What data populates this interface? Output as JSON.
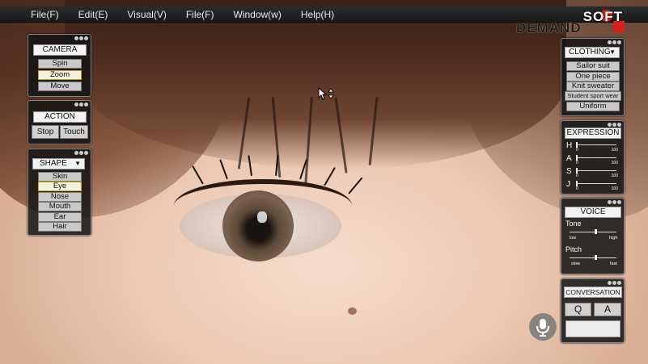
{
  "menu": [
    "File(F)",
    "Edit(E)",
    "Visual(V)",
    "File(F)",
    "Window(w)",
    "Help(H)"
  ],
  "logo": {
    "top": "SOFT",
    "bottom": "DEMAND",
    "accent_color": "#d4231e"
  },
  "camera": {
    "title": "CAMERA",
    "buttons": [
      "Spin",
      "Zoom",
      "Move"
    ],
    "active": "Zoom"
  },
  "action": {
    "title": "ACTION",
    "buttons": [
      "Stop",
      "Touch"
    ]
  },
  "shape": {
    "title": "SHAPE",
    "buttons": [
      "Skin",
      "Eye",
      "Nose",
      "Mouth",
      "Ear",
      "Hair"
    ],
    "active": "Eye"
  },
  "clothing": {
    "title": "CLOTHING",
    "items": [
      "Sailor suit",
      "One piece",
      "Knit sweater",
      "Student sport wear",
      "Uniform"
    ]
  },
  "expression": {
    "title": "EXPRESSION",
    "sliders": [
      {
        "label": "H",
        "min": "0",
        "max": "100",
        "value": 0
      },
      {
        "label": "A",
        "min": "0",
        "max": "100",
        "value": 0
      },
      {
        "label": "S",
        "min": "0",
        "max": "100",
        "value": 0
      },
      {
        "label": "J",
        "min": "0",
        "max": "100",
        "value": 0
      }
    ]
  },
  "voice": {
    "title": "VOICE",
    "tone": {
      "label": "Tone",
      "low": "low",
      "high": "high",
      "value": 0.55
    },
    "pitch": {
      "label": "Pitch",
      "low": "slow",
      "high": "fast",
      "value": 0.55
    }
  },
  "conversation": {
    "title": "CONVERSATION",
    "q": "Q",
    "a": "A",
    "input": ""
  },
  "icons": {
    "mic": "microphone-icon",
    "cursor": "move-cursor-icon",
    "dropdown": "dropdown-arrow-icon"
  }
}
